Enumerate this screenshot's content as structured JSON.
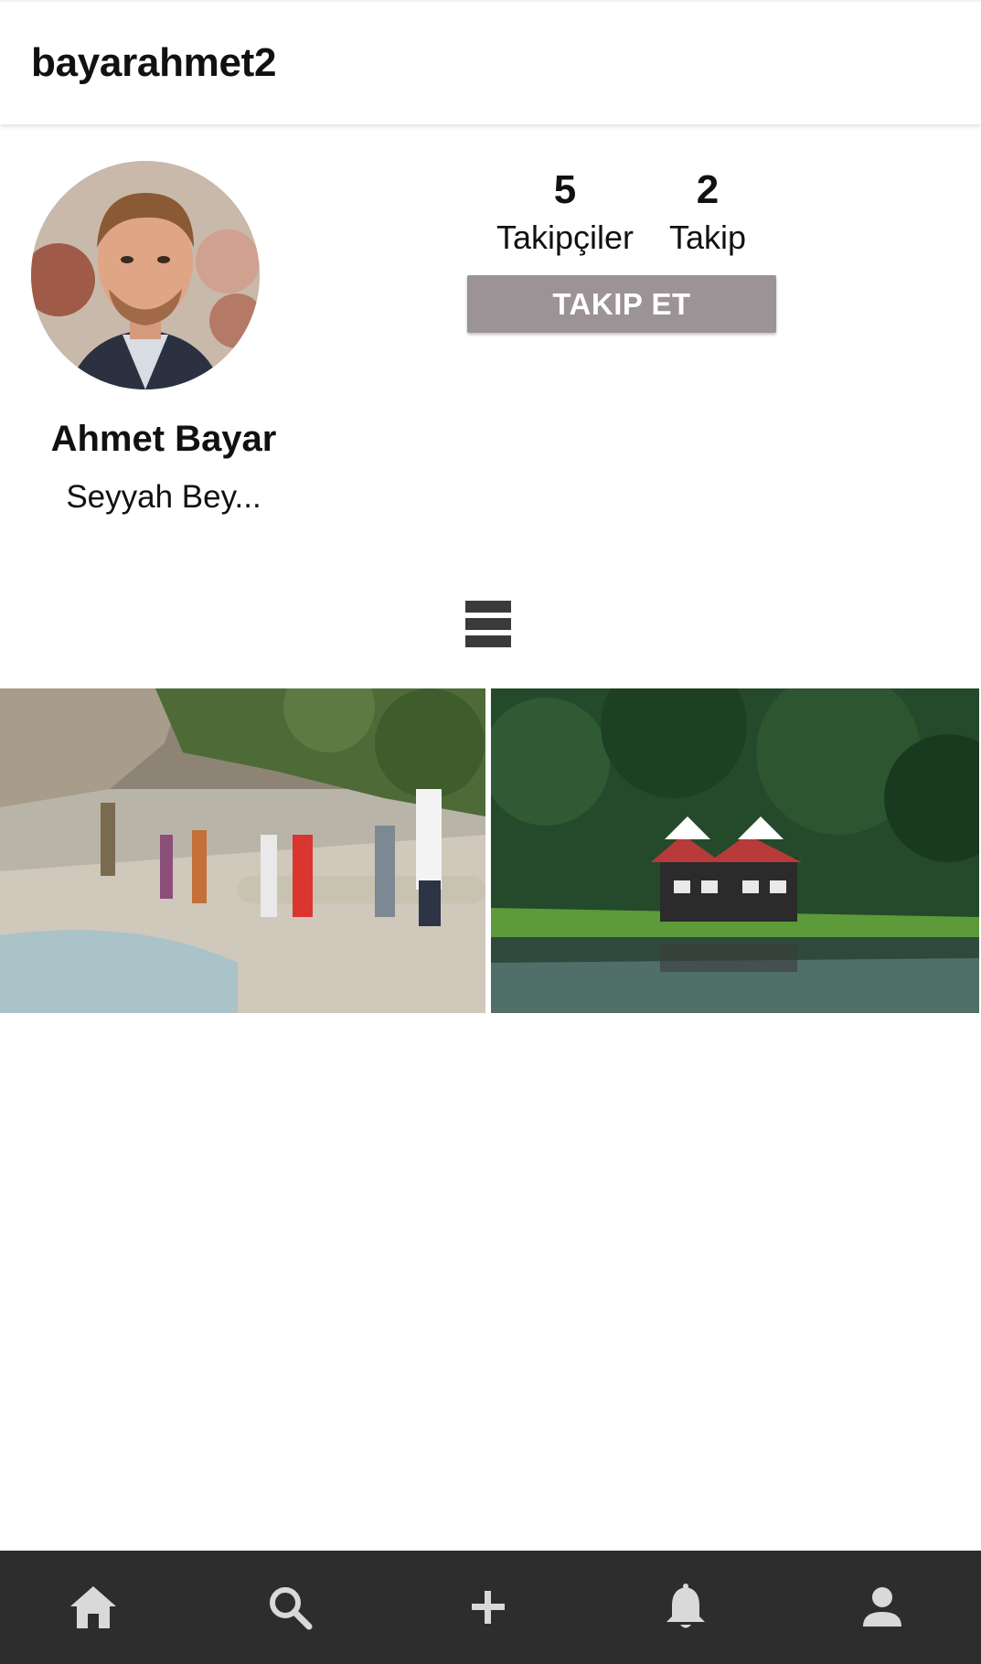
{
  "header": {
    "username": "bayarahmet2"
  },
  "profile": {
    "name": "Ahmet Bayar",
    "bio": "Seyyah Bey...",
    "followers_count": "5",
    "followers_label": "Takipçiler",
    "following_count": "2",
    "following_label": "Takip",
    "follow_button": "TAKIP ET"
  },
  "view_toggle_icon": "list-view-icon",
  "posts": [
    {
      "icon": "post-photo-hikers"
    },
    {
      "icon": "post-photo-lake-house"
    }
  ],
  "bottom_nav": [
    {
      "icon": "home-icon"
    },
    {
      "icon": "search-icon"
    },
    {
      "icon": "add-icon"
    },
    {
      "icon": "bell-icon"
    },
    {
      "icon": "profile-icon"
    }
  ],
  "colors": {
    "follow_button_bg": "#9b9395",
    "bottom_nav_bg": "#2d2d2d",
    "nav_icon": "#d9d9d9"
  }
}
